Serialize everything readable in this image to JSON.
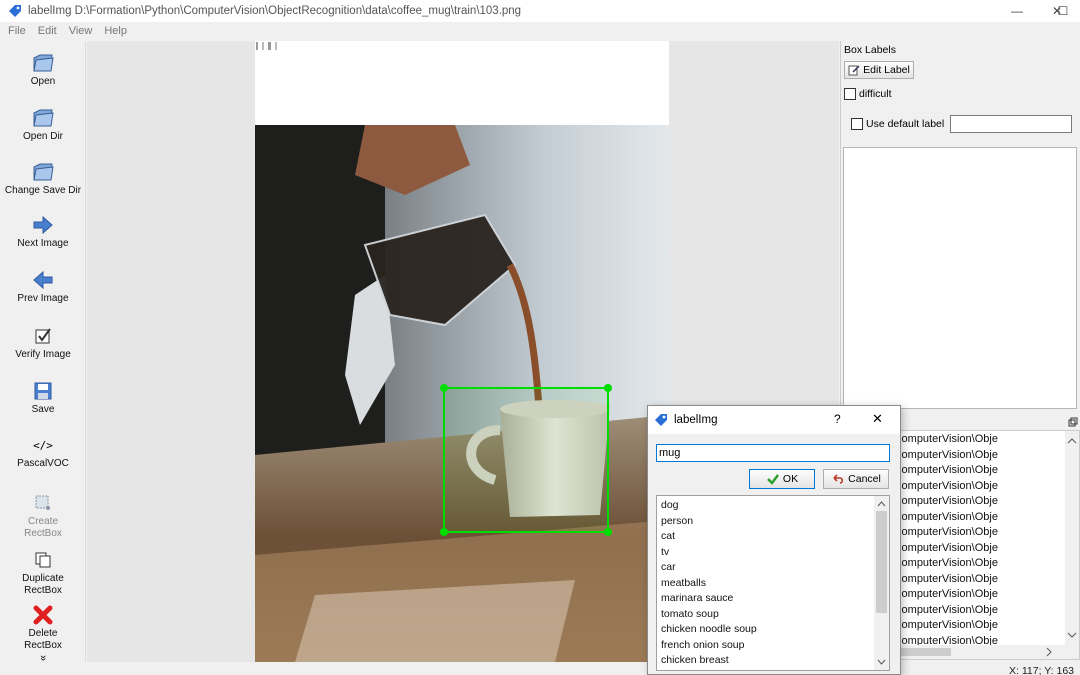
{
  "window": {
    "title": "labelImg D:\\Formation\\Python\\ComputerVision\\ObjectRecognition\\data\\coffee_mug\\train\\103.png",
    "controls": {
      "minimize": "—",
      "maximize": "☐",
      "close": "✕"
    }
  },
  "menu": [
    "File",
    "Edit",
    "View",
    "Help"
  ],
  "toolbar": {
    "open": "Open",
    "open_dir": "Open Dir",
    "change_save_dir": "Change Save Dir",
    "next_image": "Next Image",
    "prev_image": "Prev Image",
    "verify_image": "Verify Image",
    "save": "Save",
    "format_icon_text": "</>",
    "format": "PascalVOC",
    "create_rectbox": [
      "Create",
      "RectBox"
    ],
    "duplicate_rectbox": [
      "Duplicate",
      "RectBox"
    ],
    "delete_rectbox": [
      "Delete",
      "RectBox"
    ],
    "more": "»"
  },
  "box_labels": {
    "title": "Box Labels",
    "edit_label_button": "Edit Label",
    "difficult_label": "difficult",
    "use_default_label": "Use default label",
    "default_label_value": ""
  },
  "file_list": {
    "rows": [
      "on\\Python\\ComputerVision\\Obje",
      "on\\Python\\ComputerVision\\Obje",
      "on\\Python\\ComputerVision\\Obje",
      "on\\Python\\ComputerVision\\Obje",
      "on\\Python\\ComputerVision\\Obje",
      "on\\Python\\ComputerVision\\Obje",
      "on\\Python\\ComputerVision\\Obje",
      "on\\Python\\ComputerVision\\Obje",
      "on\\Python\\ComputerVision\\Obje",
      "on\\Python\\ComputerVision\\Obje",
      "on\\Python\\ComputerVision\\Obje",
      "on\\Python\\ComputerVision\\Obje",
      "on\\Python\\ComputerVision\\Obje",
      "on\\Python\\ComputerVision\\Obje"
    ]
  },
  "status": {
    "coords": "X: 117; Y: 163"
  },
  "dialog": {
    "title": "labelImg",
    "help": "?",
    "close": "✕",
    "input_value": "mug",
    "ok": "OK",
    "cancel": "Cancel",
    "labels": [
      "dog",
      "person",
      "cat",
      "tv",
      "car",
      "meatballs",
      "marinara sauce",
      "tomato soup",
      "chicken noodle soup",
      "french onion soup",
      "chicken breast"
    ]
  },
  "colors": {
    "bbox": "#00dd00",
    "accent": "#0078d7"
  }
}
